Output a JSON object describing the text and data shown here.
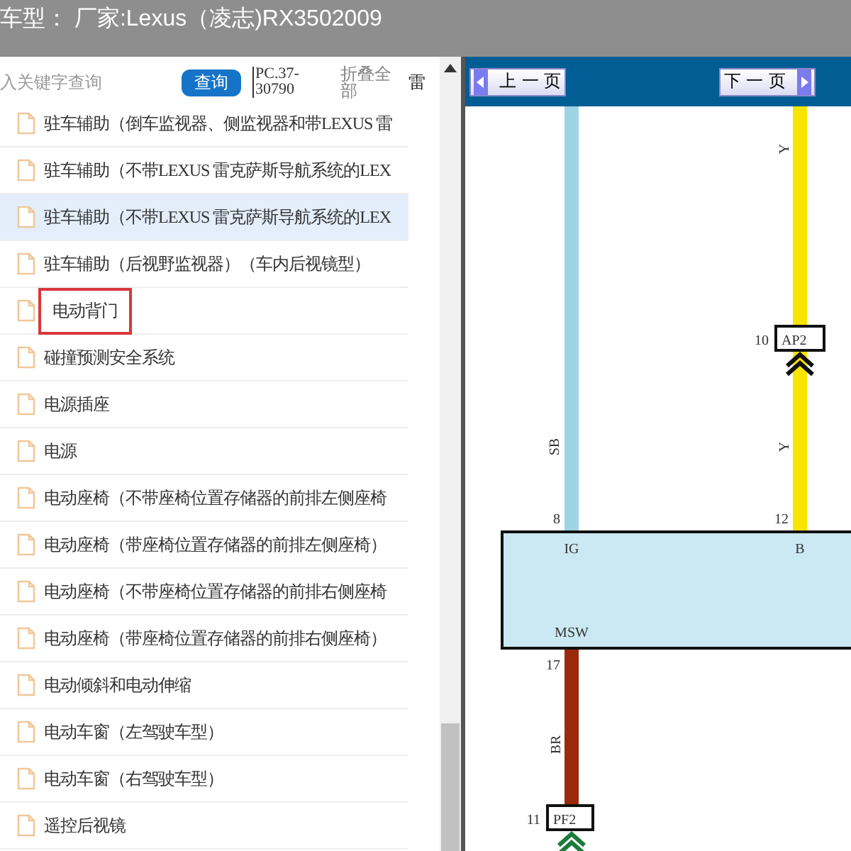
{
  "header": {
    "title": "车型：  厂家:Lexus（凌志)RX3502009"
  },
  "toolbar": {
    "search": {
      "placeholder": "入关键字查询"
    },
    "search_button": "查询",
    "code": "PC.37-30790",
    "collapse_all": "折叠全部",
    "column_3": "雷"
  },
  "tree": {
    "items": [
      {
        "label": "驻车辅助（倒车监视器、侧监视器和带LEXUS 雷",
        "selected": false,
        "boxed": false
      },
      {
        "label": "驻车辅助（不带LEXUS 雷克萨斯导航系统的LEX",
        "selected": false,
        "boxed": false
      },
      {
        "label": "驻车辅助（不带LEXUS 雷克萨斯导航系统的LEX",
        "selected": true,
        "boxed": false
      },
      {
        "label": "驻车辅助（后视野监视器）（车内后视镜型）",
        "selected": false,
        "boxed": false
      },
      {
        "label": "电动背门",
        "selected": false,
        "boxed": true
      },
      {
        "label": "碰撞预测安全系统",
        "selected": false,
        "boxed": false
      },
      {
        "label": "电源插座",
        "selected": false,
        "boxed": false
      },
      {
        "label": "电源",
        "selected": false,
        "boxed": false
      },
      {
        "label": "电动座椅（不带座椅位置存储器的前排左侧座椅",
        "selected": false,
        "boxed": false
      },
      {
        "label": "电动座椅（带座椅位置存储器的前排左侧座椅）",
        "selected": false,
        "boxed": false
      },
      {
        "label": "电动座椅（不带座椅位置存储器的前排右侧座椅",
        "selected": false,
        "boxed": false
      },
      {
        "label": "电动座椅（带座椅位置存储器的前排右侧座椅）",
        "selected": false,
        "boxed": false
      },
      {
        "label": "电动倾斜和电动伸缩",
        "selected": false,
        "boxed": false
      },
      {
        "label": "电动车窗（左驾驶车型）",
        "selected": false,
        "boxed": false
      },
      {
        "label": "电动车窗（右驾驶车型）",
        "selected": false,
        "boxed": false
      },
      {
        "label": "遥控后视镜",
        "selected": false,
        "boxed": false
      }
    ]
  },
  "viewer": {
    "prev_button": "上 一 页",
    "next_button": "下 一 页",
    "diagram": {
      "wires": [
        {
          "color": "#9dd4e4",
          "labels": [
            "SB"
          ]
        },
        {
          "color": "#f7e400",
          "labels": [
            "Y",
            "Y"
          ]
        },
        {
          "color": "#9b2a0b",
          "labels": [
            "BR"
          ]
        }
      ],
      "connectors": [
        {
          "name": "AP2",
          "pin": "10"
        },
        {
          "name": "PF2",
          "pin": "11"
        }
      ],
      "component": {
        "terminals": [
          {
            "name": "IG",
            "pin": "8"
          },
          {
            "name": "B",
            "pin": "12"
          },
          {
            "name": "MSW",
            "pin": "17"
          }
        ]
      }
    }
  }
}
